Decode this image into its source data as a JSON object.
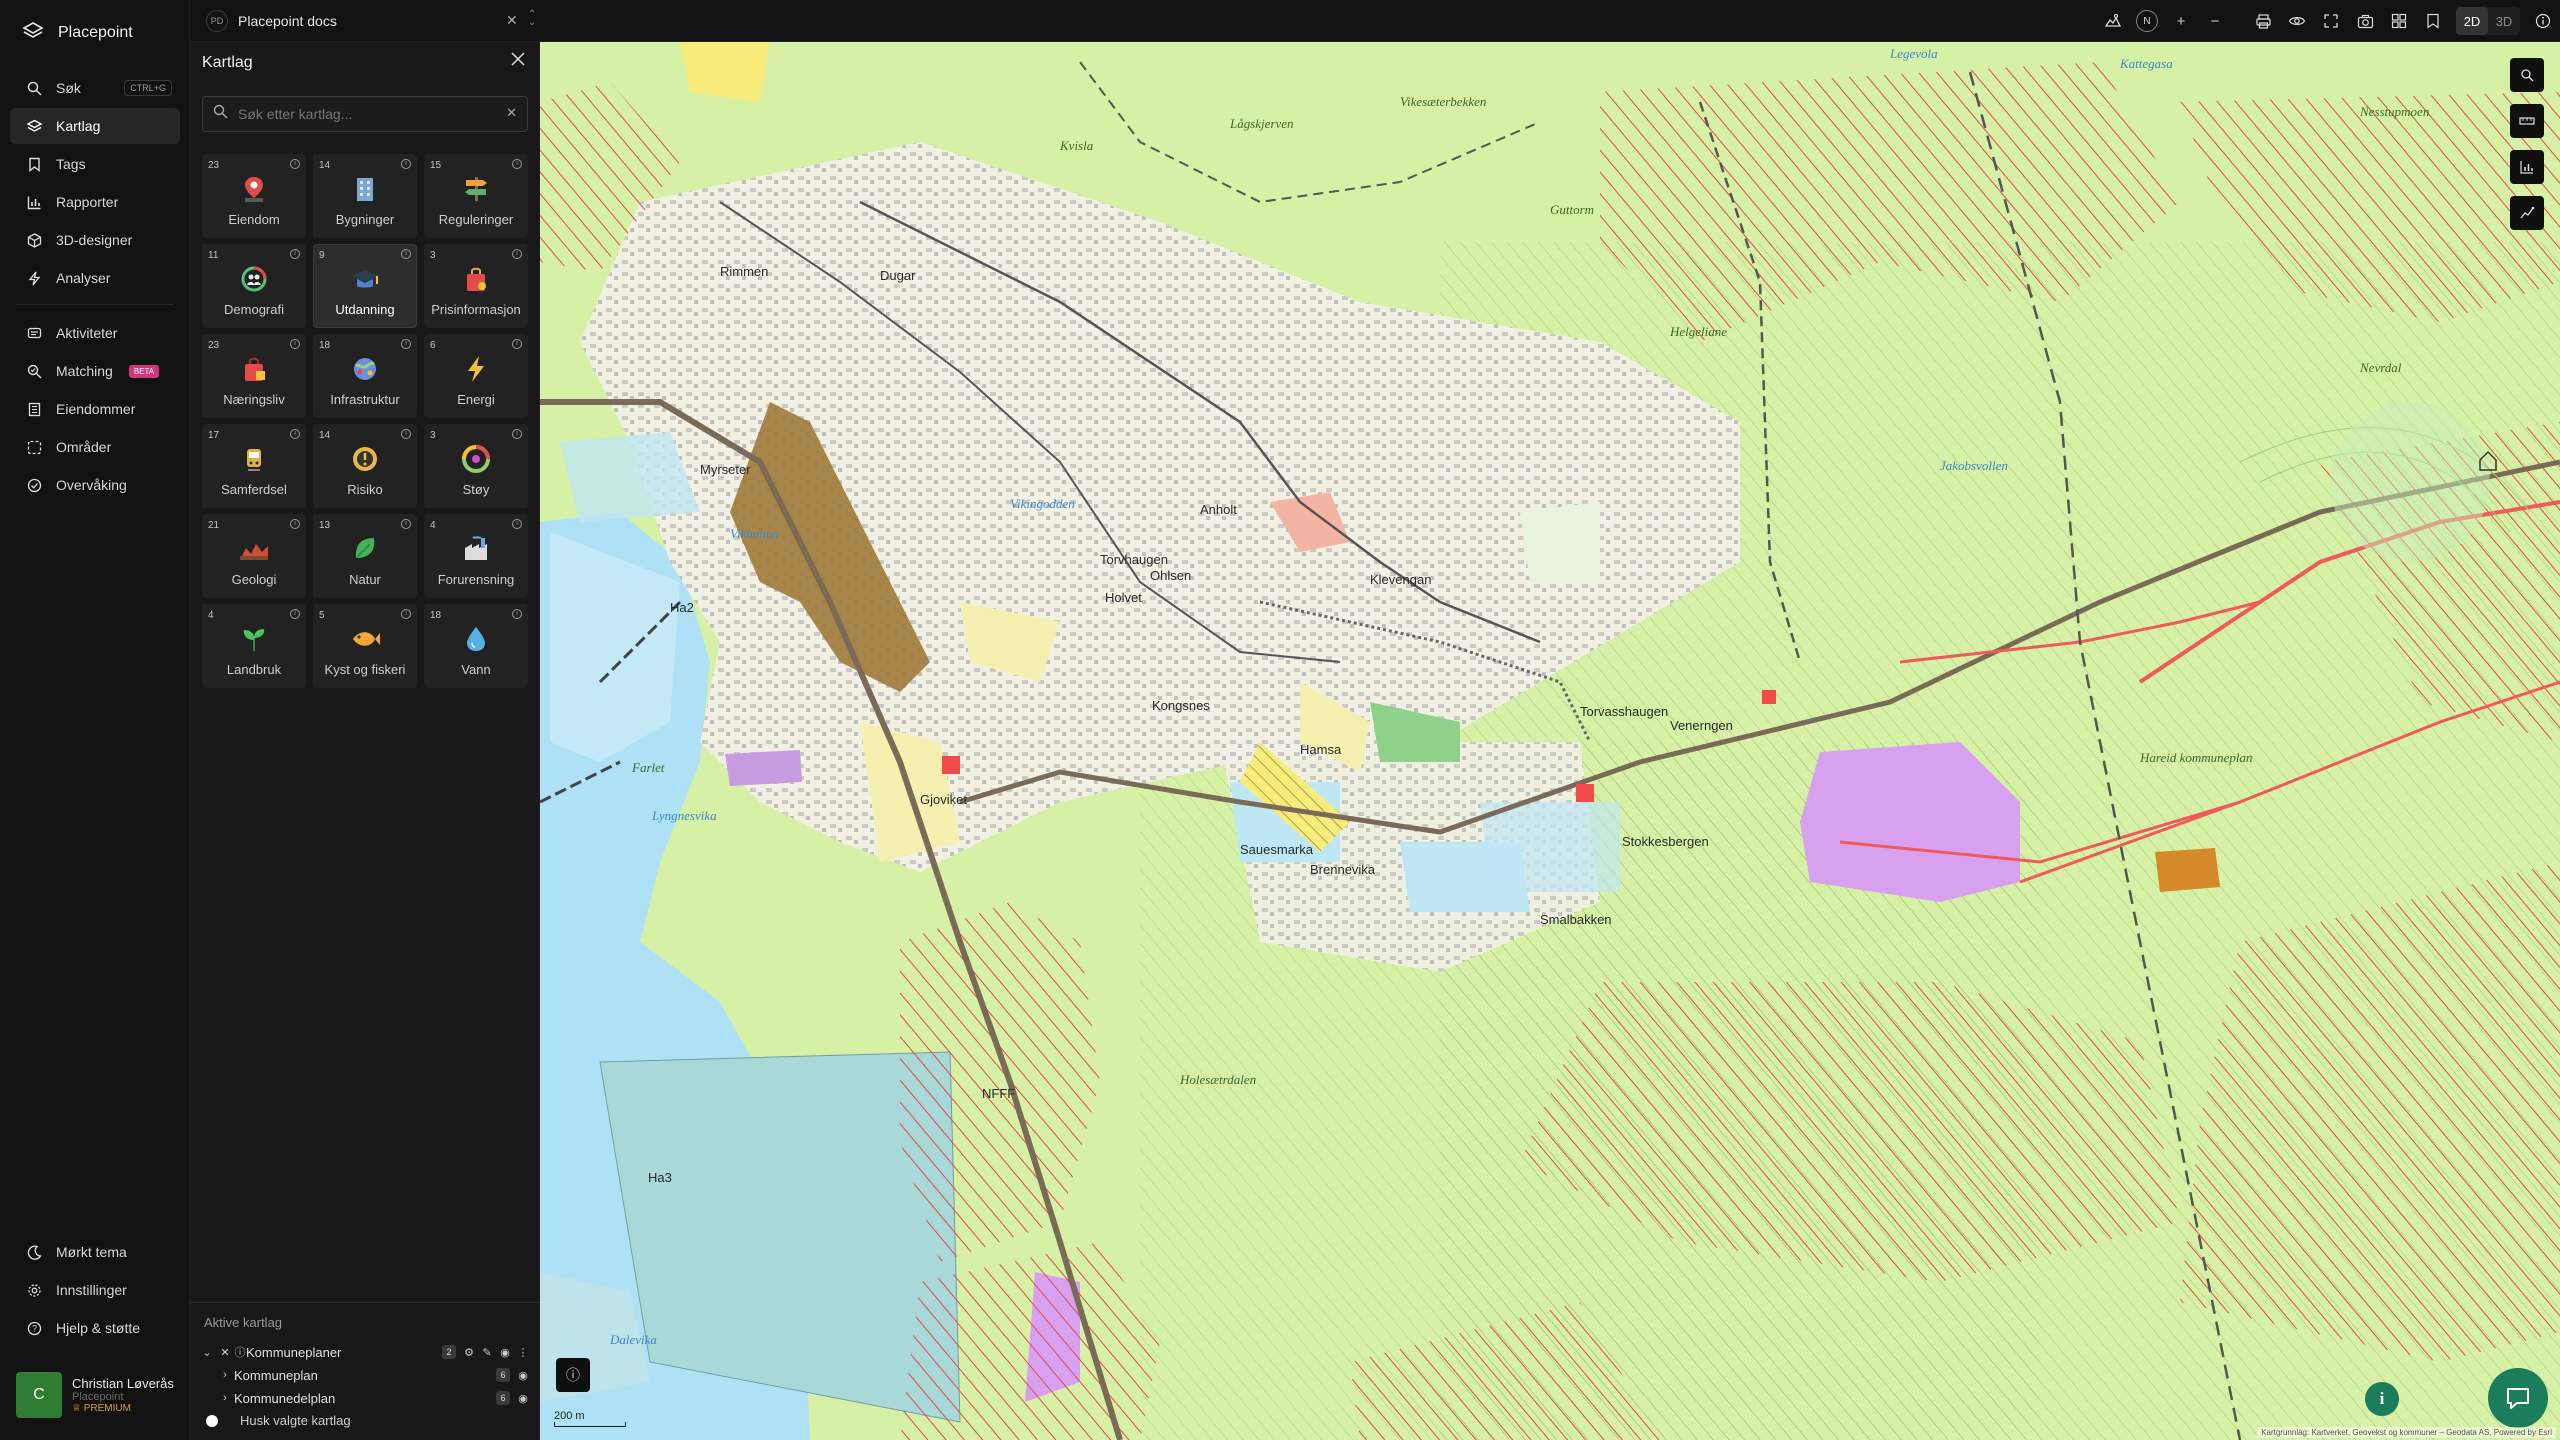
{
  "app": {
    "name": "Placepoint"
  },
  "nav": {
    "items": [
      {
        "label": "Søk",
        "icon": "search-icon",
        "shortcut": "CTRL+G"
      },
      {
        "label": "Kartlag",
        "icon": "layers-icon",
        "active": true
      },
      {
        "label": "Tags",
        "icon": "bookmark-icon"
      },
      {
        "label": "Rapporter",
        "icon": "bar-chart-icon"
      },
      {
        "label": "3D-designer",
        "icon": "cube-icon"
      },
      {
        "label": "Analyser",
        "icon": "bolt-icon"
      }
    ],
    "items2": [
      {
        "label": "Aktiviteter",
        "icon": "bell-icon"
      },
      {
        "label": "Matching",
        "icon": "matching-icon",
        "badge": "BETA"
      },
      {
        "label": "Eiendommer",
        "icon": "building-icon"
      },
      {
        "label": "Områder",
        "icon": "area-icon"
      },
      {
        "label": "Overvåking",
        "icon": "monitor-icon"
      }
    ],
    "bottom": [
      {
        "label": "Mørkt tema",
        "icon": "moon-icon"
      },
      {
        "label": "Innstillinger",
        "icon": "gear-icon"
      },
      {
        "label": "Hjelp & støtte",
        "icon": "help-icon"
      }
    ]
  },
  "user": {
    "initial": "C",
    "name": "Christian Løverås",
    "org": "Placepoint",
    "plan": "PREMIUM"
  },
  "workspace": {
    "badge": "PD",
    "name": "Placepoint docs"
  },
  "toolbar": {
    "north": "N",
    "mode_2d": "2D",
    "mode_3d": "3D"
  },
  "panel": {
    "title": "Kartlag",
    "search_placeholder": "Søk etter kartlag...",
    "categories": [
      {
        "label": "Eiendom",
        "count": "23",
        "icon": "pin-icon",
        "color": "#e24b4b"
      },
      {
        "label": "Bygninger",
        "count": "14",
        "icon": "building-icon",
        "color": "#7aa6d8"
      },
      {
        "label": "Reguleringer",
        "count": "15",
        "icon": "signpost-icon",
        "color": "#f0a23b"
      },
      {
        "label": "Demografi",
        "count": "11",
        "icon": "demography-icon",
        "color": "#4fc37a"
      },
      {
        "label": "Utdanning",
        "count": "9",
        "icon": "graduation-icon",
        "color": "#4a82d6",
        "selected": true
      },
      {
        "label": "Prisinformasjon",
        "count": "3",
        "icon": "shopping-bag-icon",
        "color": "#e24b4b"
      },
      {
        "label": "Næringsliv",
        "count": "23",
        "icon": "bag-icon",
        "color": "#e24b4b"
      },
      {
        "label": "Infrastruktur",
        "count": "18",
        "icon": "infrastructure-icon",
        "color": "#6b8fe0"
      },
      {
        "label": "Energi",
        "count": "6",
        "icon": "lightning-icon",
        "color": "#f2c230"
      },
      {
        "label": "Samferdsel",
        "count": "17",
        "icon": "tram-icon",
        "color": "#e0b04a"
      },
      {
        "label": "Risiko",
        "count": "14",
        "icon": "risk-icon",
        "color": "#e8b84a"
      },
      {
        "label": "Støy",
        "count": "3",
        "icon": "noise-icon",
        "color": "#8bd06b"
      },
      {
        "label": "Geologi",
        "count": "21",
        "icon": "geology-icon",
        "color": "#d04f3b"
      },
      {
        "label": "Natur",
        "count": "13",
        "icon": "leaf-icon",
        "color": "#44b35a"
      },
      {
        "label": "Forurensning",
        "count": "4",
        "icon": "factory-icon",
        "color": "#6fa5e0"
      },
      {
        "label": "Landbruk",
        "count": "4",
        "icon": "sprout-icon",
        "color": "#4ec25b"
      },
      {
        "label": "Kyst og fiskeri",
        "count": "5",
        "icon": "fish-icon",
        "color": "#f2a53b"
      },
      {
        "label": "Vann",
        "count": "18",
        "icon": "water-drop-icon",
        "color": "#56b0e8"
      }
    ],
    "active_title": "Aktive kartlag",
    "active_layers": {
      "group": {
        "label": "Kommuneplaner",
        "count": "2"
      },
      "children": [
        {
          "label": "Kommuneplan",
          "count": "6"
        },
        {
          "label": "Kommunedelplan",
          "count": "6"
        }
      ]
    },
    "remember_label": "Husk valgte kartlag"
  },
  "map": {
    "labels": [
      "Lågskjerven",
      "Kvisla",
      "Vikesæterbekken",
      "Legevola",
      "Kattegasa",
      "Nesstupmoen",
      "Rimmen",
      "Dugar",
      "Guttorm",
      "Helgeliane",
      "Torvhaugen",
      "Ohlsen",
      "Nevrdal",
      "Jakobsvollen",
      "Anholt",
      "Klevengan",
      "Venerngen",
      "Torvasshaugen",
      "Vikhanna",
      "Myrseter",
      "Vikingodden",
      "Gjoviket",
      "Holvet",
      "Kongsnes",
      "Farlet",
      "Lyngnesvika",
      "Ha2",
      "Ha3",
      "NFFF",
      "Hareid kommuneplan",
      "Sauesmarka",
      "Brennevika",
      "Stokkesbergen",
      "Smalbakken",
      "Holesætrdalen",
      "Dalevika",
      "Hamsa"
    ],
    "scale": "200 m",
    "attribution": "Kartgrunnlag: Kartverket, Geovekst og kommuner – Geodata AS, Powered by Esri"
  },
  "colors": {
    "accent": "#1b7d5c",
    "map_green": "#d6f0a6",
    "water": "#aee1f5",
    "hatch_red": "#e24b4b",
    "residential": "#f6f0b0",
    "industrial": "#bfe6f3",
    "center": "#a07a3a",
    "purple": "#d7a1f0"
  }
}
